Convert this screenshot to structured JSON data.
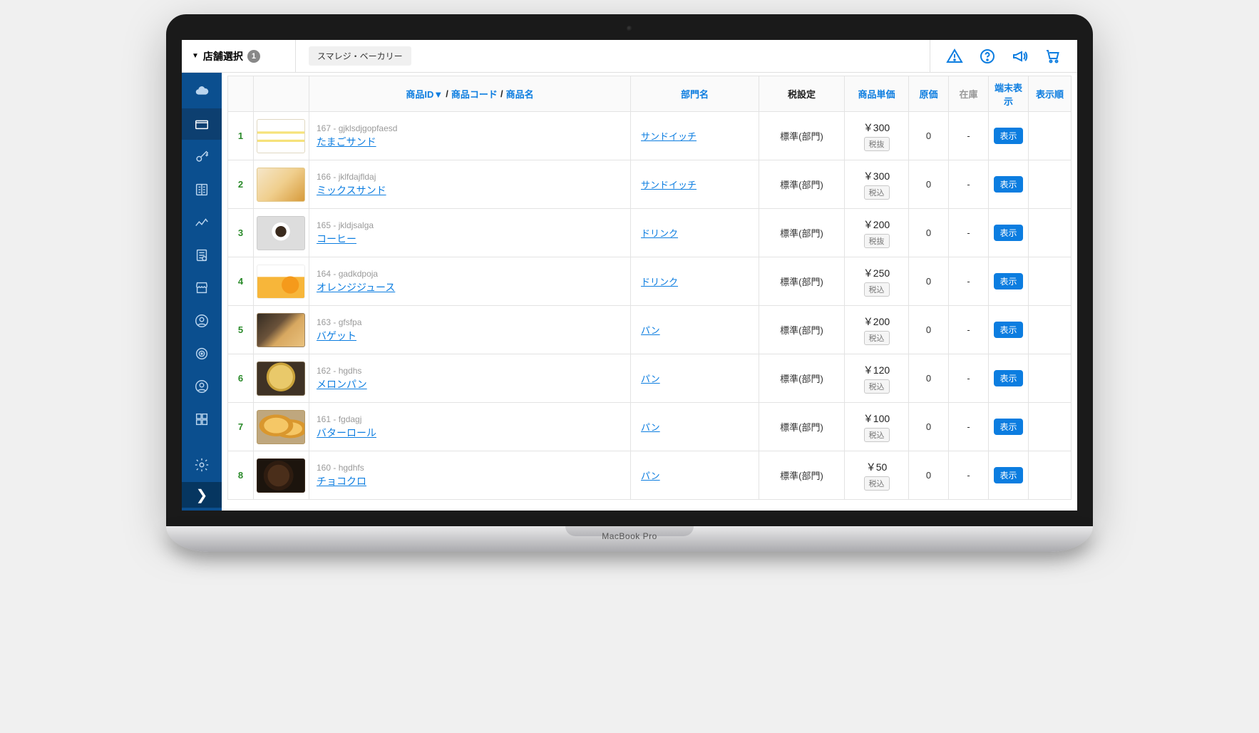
{
  "laptop_label": "MacBook Pro",
  "header": {
    "store_select_label": "店舗選択",
    "store_select_count": "1",
    "store_name": "スマレジ・ベーカリー"
  },
  "columns": {
    "product_id": "商品ID▼",
    "product_code": "商品コード",
    "product_name": "商品名",
    "department": "部門名",
    "tax": "税設定",
    "price": "商品単価",
    "cost": "原価",
    "stock": "在庫",
    "display": "端末表示",
    "order": "表示順"
  },
  "display_badge_label": "表示",
  "rows": [
    {
      "idx": "1",
      "thumb": "sandwich1",
      "id": "167",
      "code": "gjklsdjgopfaesd",
      "name": "たまごサンド",
      "dept": "サンドイッチ",
      "tax": "標準(部門)",
      "price": "￥300",
      "tax_mode": "税抜",
      "cost": "0",
      "stock": "-"
    },
    {
      "idx": "2",
      "thumb": "sandwich2",
      "id": "166",
      "code": "jklfdajfldaj",
      "name": "ミックスサンド",
      "dept": "サンドイッチ",
      "tax": "標準(部門)",
      "price": "￥300",
      "tax_mode": "税込",
      "cost": "0",
      "stock": "-"
    },
    {
      "idx": "3",
      "thumb": "coffee",
      "id": "165",
      "code": "jkldjsalga",
      "name": "コーヒー",
      "dept": "ドリンク",
      "tax": "標準(部門)",
      "price": "￥200",
      "tax_mode": "税抜",
      "cost": "0",
      "stock": "-"
    },
    {
      "idx": "4",
      "thumb": "orange",
      "id": "164",
      "code": "gadkdpoja",
      "name": "オレンジジュース",
      "dept": "ドリンク",
      "tax": "標準(部門)",
      "price": "￥250",
      "tax_mode": "税込",
      "cost": "0",
      "stock": "-"
    },
    {
      "idx": "5",
      "thumb": "baguette",
      "id": "163",
      "code": "gfsfpa",
      "name": "バゲット",
      "dept": "パン",
      "tax": "標準(部門)",
      "price": "￥200",
      "tax_mode": "税込",
      "cost": "0",
      "stock": "-"
    },
    {
      "idx": "6",
      "thumb": "melon",
      "id": "162",
      "code": "hgdhs",
      "name": "メロンパン",
      "dept": "パン",
      "tax": "標準(部門)",
      "price": "￥120",
      "tax_mode": "税込",
      "cost": "0",
      "stock": "-"
    },
    {
      "idx": "7",
      "thumb": "roll",
      "id": "161",
      "code": "fgdagj",
      "name": "バターロール",
      "dept": "パン",
      "tax": "標準(部門)",
      "price": "￥100",
      "tax_mode": "税込",
      "cost": "0",
      "stock": "-"
    },
    {
      "idx": "8",
      "thumb": "choco",
      "id": "160",
      "code": "hgdhfs",
      "name": "チョコクロ",
      "dept": "パン",
      "tax": "標準(部門)",
      "price": "￥50",
      "tax_mode": "税込",
      "cost": "0",
      "stock": "-"
    }
  ]
}
